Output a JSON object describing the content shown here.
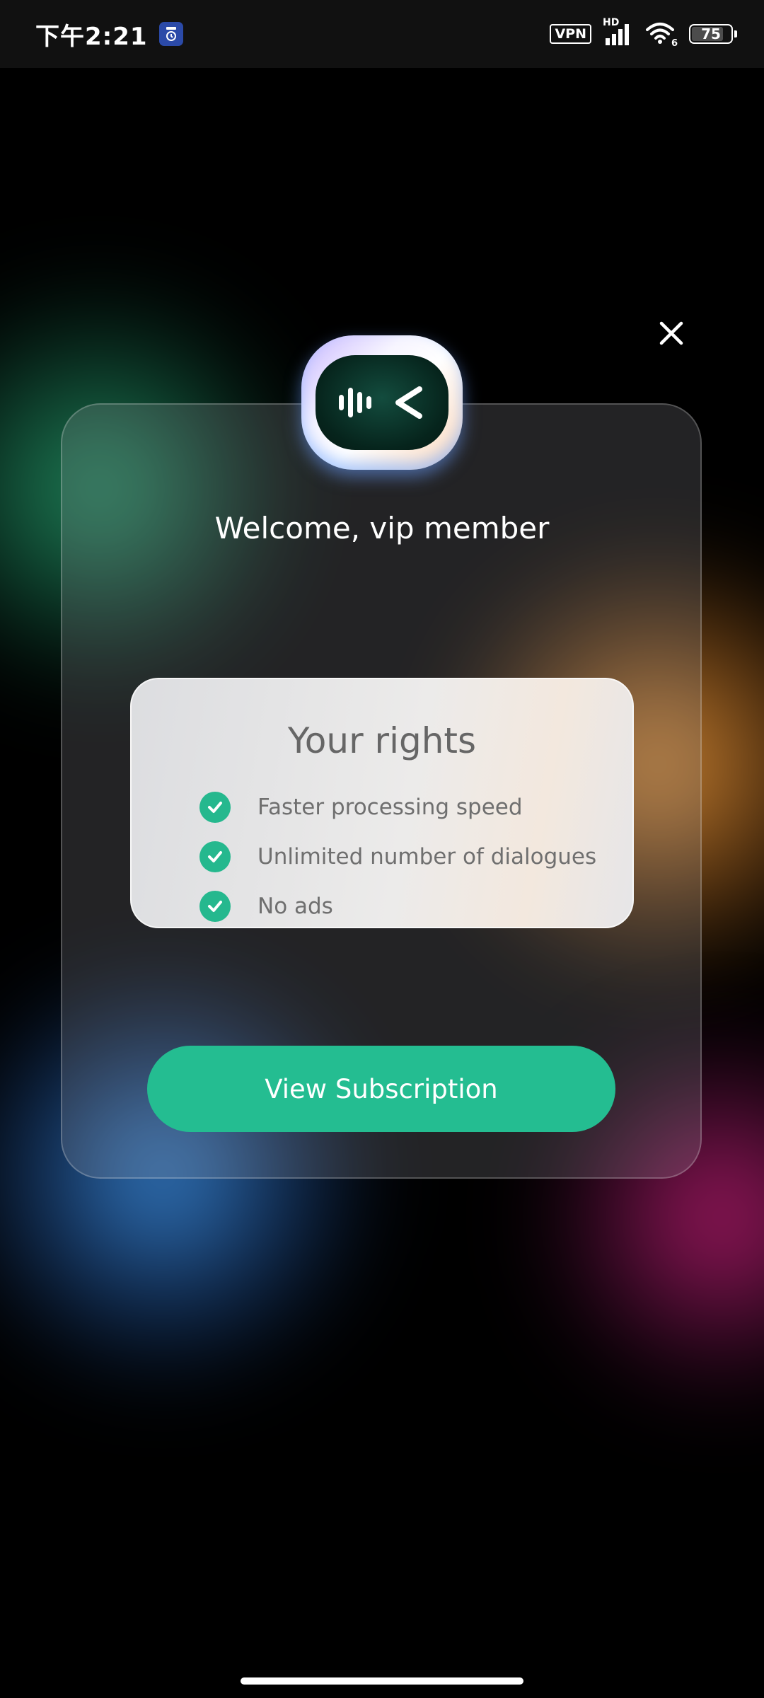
{
  "status_bar": {
    "time": "下午2:21",
    "vpn_label": "VPN",
    "network_label": "HD",
    "wifi_label": "6",
    "battery_level": "75"
  },
  "modal": {
    "welcome_text": "Welcome, vip member",
    "rights": {
      "title": "Your rights",
      "items": [
        {
          "label": "Faster processing speed",
          "icon": "check-circle-icon"
        },
        {
          "label": "Unlimited number of dialogues",
          "icon": "check-circle-icon"
        },
        {
          "label": "No ads",
          "icon": "check-circle-icon"
        }
      ]
    },
    "subscribe_button_label": "View Subscription"
  },
  "colors": {
    "accent": "#24bd91",
    "background": "#000000"
  }
}
